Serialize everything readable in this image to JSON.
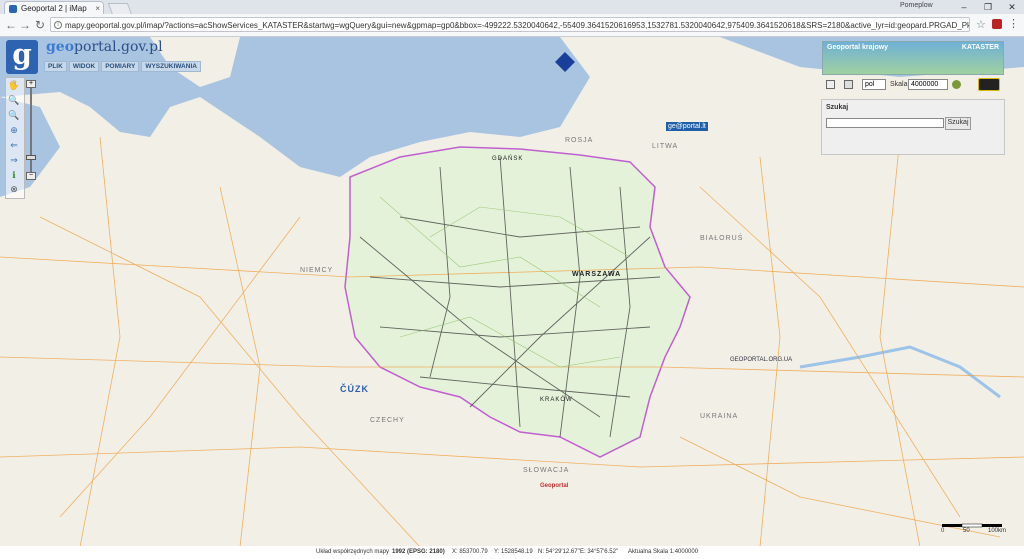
{
  "browser": {
    "tab_title": "Geoportal 2 | iMap",
    "tab_close": "×",
    "profile": "Pomeplow",
    "win_min": "–",
    "win_max": "❐",
    "win_close": "✕",
    "back": "←",
    "forward": "→",
    "reload": "↻",
    "url": "mapy.geoportal.gov.pl/imap/?actions=acShowServices_KATASTER&startwg=wgQuery&gui=new&gpmap=gp0&bbox=-499222.5320040642,-55409.3641520616953,1532781.5320040642,975409.3641520618&SRS=2180&active_lyr=id:geopard.PRGAD_PktAdres.mapId:msBDOT...",
    "star": "☆",
    "menu": "⋮"
  },
  "header": {
    "logo_letter": "g",
    "brand_prefix": "geo",
    "brand_main": "portal",
    "brand_suffix": ".gov.pl",
    "menu": [
      "PLIK",
      "WIDOK",
      "POMIARY",
      "WYSZUKIWANIA"
    ]
  },
  "zoom": {
    "plus": "+",
    "minus": "−",
    "level_fraction": 0.82
  },
  "tools": [
    "🖐",
    "🔍",
    "🔍",
    "⊕",
    "⇐",
    "⇒",
    "ℹ",
    "⊗"
  ],
  "panel": {
    "krajowy_title": "Geoportal krajowy",
    "kataster": "KATASTER",
    "lang": "pol",
    "scale_label": "Skala:",
    "scale_value": "4000000"
  },
  "search": {
    "title": "Szukaj",
    "button": "Szukaj"
  },
  "map_labels": {
    "rosja": "ROSJA",
    "litwa": "LITWA",
    "bialorus": "BIAŁORUŚ",
    "ukraina": "UKRAINA",
    "slowacja": "SŁOWACJA",
    "czechy": "CZECHY",
    "niemcy": "NIEMCY",
    "warszawa": "WARSZAWA",
    "gdansk": "GDAŃSK",
    "krakow": "KRAKÓW",
    "cuzk": "ČÚZK",
    "geoportal_lt": "ge@portal.lt",
    "geoportal_sk": "Geoportal",
    "geoportal_ua": "GEOPORTAL.ORG.UA"
  },
  "scale_bar": {
    "t0": "0",
    "t1": "50",
    "t2": "100km"
  },
  "status": {
    "crs_label": "Układ współrzędnych mapy",
    "crs": "1992 (EPSG: 2180)",
    "x": "X: 853700.79",
    "y": "Y: 1528548.19",
    "n": "N: 54°29'12.67\"",
    "e": "E: 34°57'6.52\"",
    "scale": "Aktualna Skala 1:4000000"
  },
  "colors": {
    "sea": "#a9c4e0",
    "land": "#f2efe6",
    "poland": "#e4f2da",
    "roads": "#f0a040",
    "border": "#c060d0"
  }
}
